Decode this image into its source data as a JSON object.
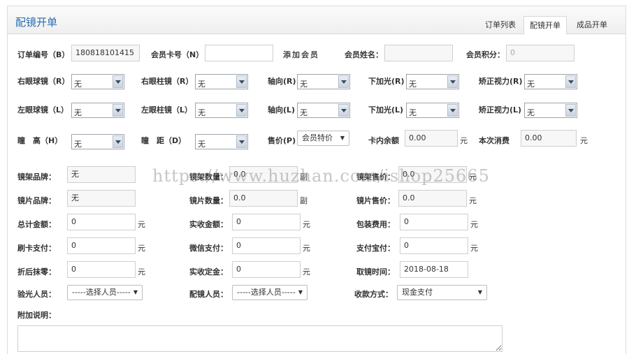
{
  "panel": {
    "title": "配镜开单"
  },
  "tabs": [
    {
      "label": "订单列表"
    },
    {
      "label": "配镜开单"
    },
    {
      "label": "成品开单"
    }
  ],
  "row1": {
    "order_no_label": "订单编号（B）",
    "order_no_value": "180818101415",
    "card_no_label": "会员卡号（N）",
    "card_no_value": "",
    "add_member": "添加会员",
    "member_name_label": "会员姓名：",
    "member_name_value": "",
    "points_label": "会员积分：",
    "points_value": "0"
  },
  "right_eye": {
    "sphere_label": "右眼球镜（R）",
    "sphere_value": "无",
    "cyl_label": "右眼柱镜（R）",
    "cyl_value": "无",
    "axis_label": "轴向(R)",
    "axis_value": "无",
    "add_label": "下加光(R)",
    "add_value": "无",
    "va_label": "矫正视力(R)",
    "va_value": "无"
  },
  "left_eye": {
    "sphere_label": "左眼球镜（L）",
    "sphere_value": "无",
    "cyl_label": "左眼柱镜（L）",
    "cyl_value": "无",
    "axis_label": "轴向(L)",
    "axis_value": "无",
    "add_label": "下加光(L)",
    "add_value": "无",
    "va_label": "矫正视力(L)",
    "va_value": "无"
  },
  "row4": {
    "height_label": "瞳　高（H）",
    "height_value": "无",
    "pd_label": "瞳　距（D）",
    "pd_value": "无",
    "price_label": "售价(P)",
    "price_value": "会员特价",
    "balance_label": "卡内余额",
    "balance_value": "0.00",
    "balance_unit": "元",
    "consume_label": "本次消费",
    "consume_value": "0.00",
    "consume_unit": "元"
  },
  "frame": {
    "brand_label": "镜架品牌：",
    "brand_value": "无",
    "qty_label": "镜架数量：",
    "qty_value": "0.0",
    "qty_unit": "副",
    "price_label": "镜架售价：",
    "price_value": "0.0",
    "price_unit": "元"
  },
  "lens": {
    "brand_label": "镜片品牌：",
    "brand_value": "无",
    "qty_label": "镜片数量：",
    "qty_value": "0.0",
    "qty_unit": "副",
    "price_label": "镜片售价：",
    "price_value": "0.0",
    "price_unit": "元"
  },
  "totals": {
    "total_label": "总计金额：",
    "total_value": "0",
    "total_unit": "元",
    "received_label": "实收金额：",
    "received_value": "0",
    "received_unit": "元",
    "pack_label": "包装费用：",
    "pack_value": "0",
    "pack_unit": "元"
  },
  "payments": {
    "card_label": "刷卡支付：",
    "card_value": "0",
    "card_unit": "元",
    "wechat_label": "微信支付：",
    "wechat_value": "0",
    "wechat_unit": "元",
    "alipay_label": "支付宝付：",
    "alipay_value": "0",
    "alipay_unit": "元"
  },
  "misc": {
    "discount_label": "折后抹零：",
    "discount_value": "0",
    "discount_unit": "元",
    "deposit_label": "实收定金：",
    "deposit_value": "0",
    "deposit_unit": "元",
    "pickup_label": "取镜时间：",
    "pickup_value": "2018-08-18"
  },
  "staff": {
    "optometrist_label": "验光人员：",
    "optometrist_value": "-----选择人员-----",
    "fitter_label": "配镜人员：",
    "fitter_value": "-----选择人员-----",
    "payment_method_label": "收款方式：",
    "payment_method_value": "现金支付"
  },
  "notes": {
    "label": "附加说明：",
    "value": ""
  },
  "watermark": "https://www.huzhan.com/ishop25665"
}
